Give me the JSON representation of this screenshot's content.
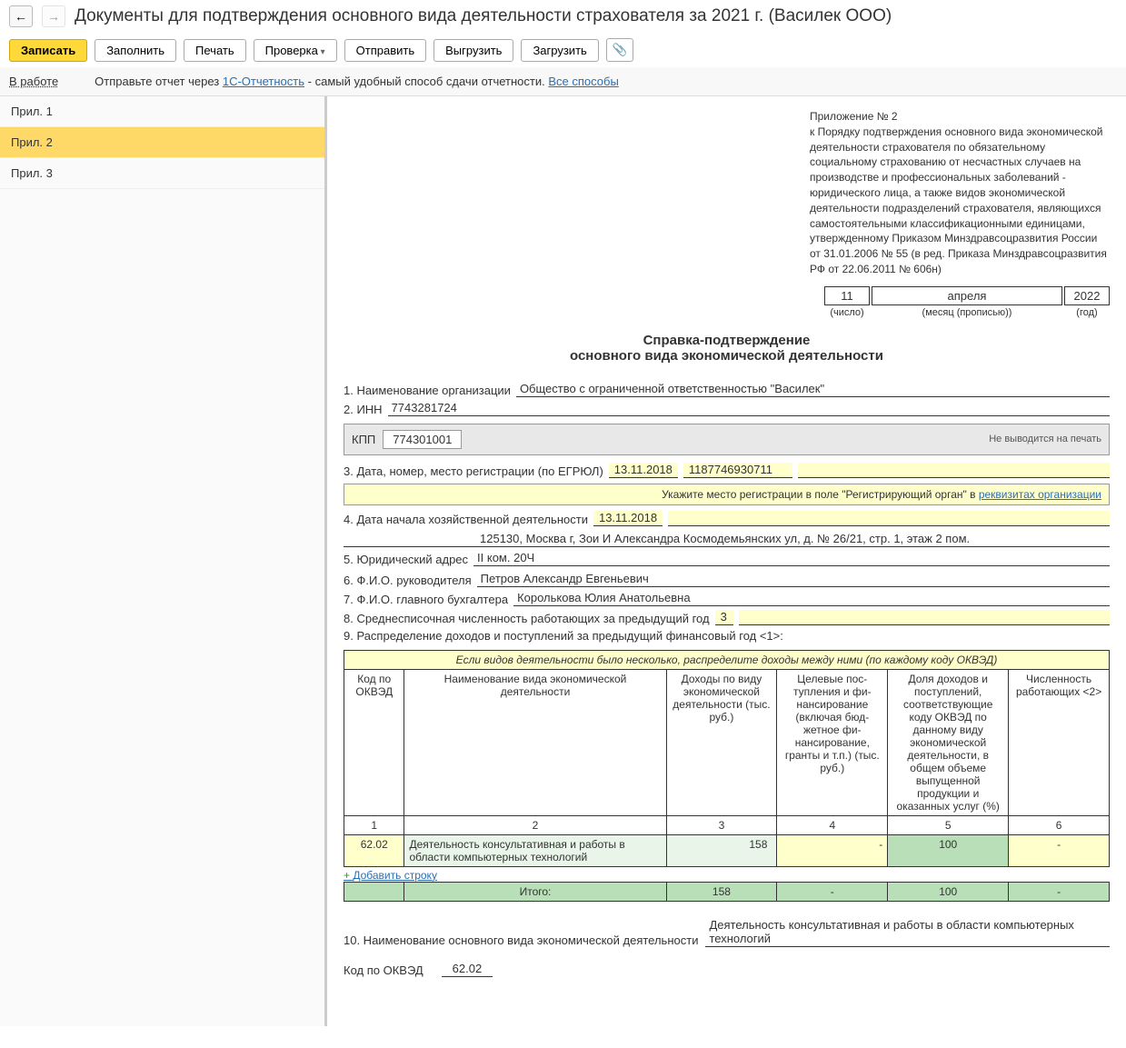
{
  "header": {
    "title": "Документы для подтверждения основного вида деятельности страхователя за 2021 г. (Василек ООО)"
  },
  "toolbar": {
    "save": "Записать",
    "fill": "Заполнить",
    "print": "Печать",
    "check": "Проверка",
    "send": "Отправить",
    "export": "Выгрузить",
    "import": "Загрузить"
  },
  "status": {
    "state": "В работе",
    "hint_pre": "Отправьте отчет через ",
    "hint_link": "1С-Отчетность",
    "hint_post": " - самый удобный способ сдачи отчетности. ",
    "hint_all": "Все способы"
  },
  "sidebar": {
    "items": [
      {
        "label": "Прил. 1"
      },
      {
        "label": "Прил. 2"
      },
      {
        "label": "Прил. 3"
      }
    ]
  },
  "attachment": {
    "title": "Приложение № 2",
    "body": "к Порядку подтверждения основного вида экономической деятельности страхователя по обязательному социальному страхованию от несчастных случаев на производстве и профессиональных заболеваний - юридического лица, а также видов экономической деятельности подразделений страхователя, являющихся самостоятельными классификационными единицами, утвержденному Приказом Минздравсоцразвития России от 31.01.2006 № 55 (в ред. Приказа Минздравсоцразвития РФ от 22.06.2011 № 606н)"
  },
  "date": {
    "day": "11",
    "month": "апреля",
    "year": "2022",
    "c_day": "(число)",
    "c_month": "(месяц (прописью))",
    "c_year": "(год)"
  },
  "doc_title": {
    "line1": "Справка-подтверждение",
    "line2": "основного вида экономической деятельности"
  },
  "fields": {
    "f1_label": "1. Наименование организации",
    "f1_val": "Общество с ограниченной ответственностью \"Василек\"",
    "f2_label": "2. ИНН",
    "f2_val": "7743281724",
    "kpp_label": "КПП",
    "kpp_val": "774301001",
    "kpp_note": "Не выводится на печать",
    "f3_label": "3. Дата, номер, место регистрации (по ЕГРЮЛ)",
    "f3_date": "13.11.2018",
    "f3_num": "1187746930711",
    "reg_hint_pre": "Укажите место регистрации в поле \"Регистрирующий орган\" в ",
    "reg_hint_link": "реквизитах организации",
    "f4_label": "4. Дата начала хозяйственной деятельности",
    "f4_val": "13.11.2018",
    "f5_label": "5. Юридический адрес",
    "f5_top": "125130, Москва г, Зои И Александра Космодемьянских ул, д. № 26/21, стр. 1, этаж 2 пом.",
    "f5_bot": "II ком. 20Ч",
    "f6_label": "6. Ф.И.О. руководителя",
    "f6_val": "Петров Александр Евгеньевич",
    "f7_label": "7. Ф.И.О. главного бухгалтера",
    "f7_val": "Королькова Юлия Анатольевна",
    "f8_label": "8. Среднесписочная численность работающих за предыдущий год",
    "f8_val": "3",
    "f9_label": "9. Распределение доходов и поступлений за предыдущий финансовый год <1>:",
    "f10_label": "10. Наименование основного вида экономической деятельности",
    "f10_val": "Деятельность консультативная и работы в области компьютерных технологий",
    "okved_label": "Код по ОКВЭД",
    "okved_val": "62.02"
  },
  "table": {
    "hint": "Если видов деятельности было несколько, распределите доходы между ними (по каждому коду ОКВЭД)",
    "h1": "Код по ОКВЭД",
    "h2": "Наименование вида экономической деятельности",
    "h3": "Доходы по виду экономической деятельности (тыс. руб.)",
    "h4": "Целевые пос- тупления и фи- нансирование (включая бюд- жетное фи- нансирование, гранты и т.п.) (тыс. руб.)",
    "h5": "Доля доходов и поступлений, соответствующие коду ОКВЭД по данному виду экономической деятельности, в общем объеме выпущенной продукции и оказанных услуг (%)",
    "h6": "Численность работающих <2>",
    "c1": "1",
    "c2": "2",
    "c3": "3",
    "c4": "4",
    "c5": "5",
    "c6": "6",
    "row": {
      "code": "62.02",
      "name": "Деятельность консультативная и работы в области компьютерных технологий",
      "income": "158",
      "target": "-",
      "pct": "100",
      "cnt": "-"
    },
    "add": "Добавить строку",
    "total_label": "Итого:",
    "total_income": "158",
    "total_target": "-",
    "total_pct": "100",
    "total_cnt": "-"
  }
}
